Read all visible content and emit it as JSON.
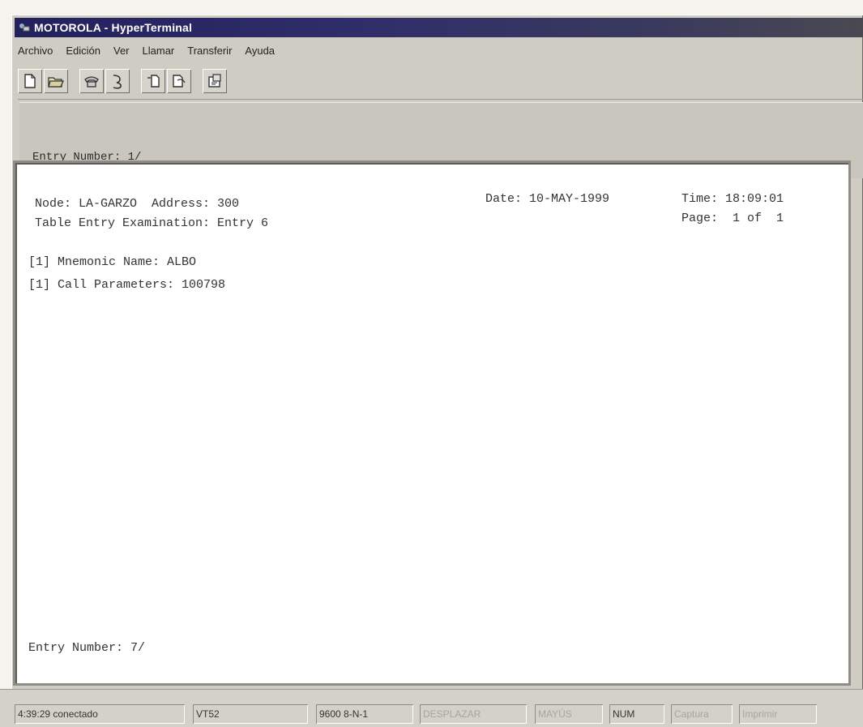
{
  "window": {
    "title": "MOTOROLA - HyperTerminal"
  },
  "menu": [
    {
      "label": "Archivo"
    },
    {
      "label": "Edición"
    },
    {
      "label": "Ver"
    },
    {
      "label": "Llamar"
    },
    {
      "label": "Transferir"
    },
    {
      "label": "Ayuda"
    }
  ],
  "toolbar": {
    "buttons": [
      {
        "icon": "new-document-icon"
      },
      {
        "icon": "open-folder-icon"
      },
      {
        "icon": "connect-phone-icon"
      },
      {
        "icon": "disconnect-icon"
      },
      {
        "icon": "send-file-icon"
      },
      {
        "icon": "receive-file-icon"
      },
      {
        "icon": "properties-icon"
      }
    ]
  },
  "upper_terminal": {
    "entry_line": "Entry Number: 1/"
  },
  "terminal": {
    "node_line": "Node: LA-GARZO  Address: 300",
    "date_line": "Date: 10-MAY-1999",
    "time_line": "Time: 18:09:01",
    "table_line": "Table Entry Examination: Entry 6",
    "page_line": "Page:  1 of  1",
    "mnemonic_line": "[1] Mnemonic Name: ALBO",
    "call_params_line": "[1] Call Parameters: 100798",
    "entry_line": "Entry Number: 7/"
  },
  "status": {
    "connection": "4:39:29 conectado",
    "emulation": "VT52",
    "settings": "9600 8-N-1",
    "scroll": "DESPLAZAR",
    "caps": "MAYÚS",
    "num": "NUM",
    "capture": "Captura",
    "print": "Imprimir"
  },
  "colors": {
    "titlebar": "#22215c",
    "window_bg": "#cfccc4",
    "terminal_bg": "#ffffff"
  }
}
